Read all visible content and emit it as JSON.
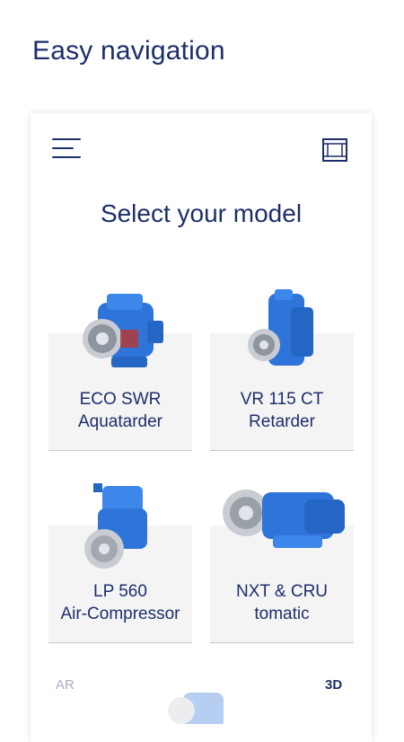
{
  "headline": "Easy navigation",
  "app": {
    "title": "Select your model",
    "menu_icon": "hamburger-menu-icon",
    "ar_icon": "ar-frame-icon",
    "models": [
      {
        "line1": "ECO SWR",
        "line2": "Aquatarder"
      },
      {
        "line1": "VR 115 CT",
        "line2": "Retarder"
      },
      {
        "line1": "LP 560",
        "line2": "Air-Compressor"
      },
      {
        "line1": "NXT & CRU",
        "line2": "tomatic"
      }
    ],
    "view_toggle": {
      "ar": "AR",
      "d3": "3D"
    }
  },
  "colors": {
    "brand_navy": "#1d2f6b",
    "product_blue": "#2f74d9",
    "tile_bg": "#f4f4f4"
  }
}
